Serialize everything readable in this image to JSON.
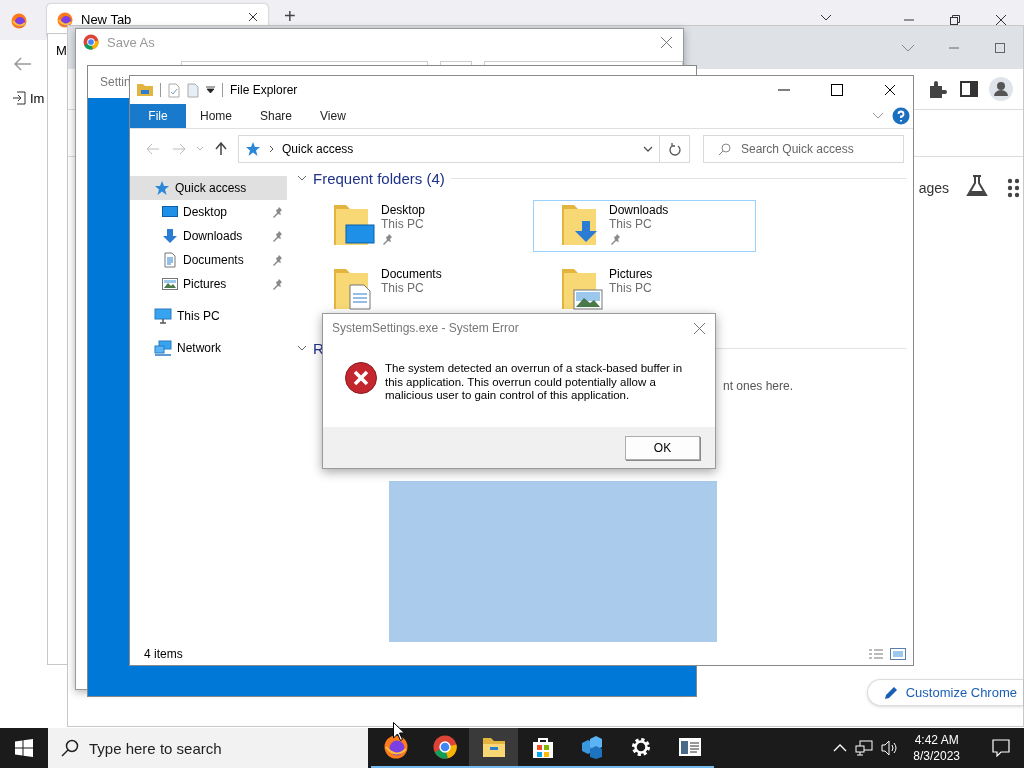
{
  "firefox": {
    "tab_title": "New Tab",
    "new_tab": "+",
    "bookmark": "Im",
    "behind_window_label": "M"
  },
  "chrome": {
    "partial_label": "ages",
    "customize_button": "Customize Chrome"
  },
  "save_as": {
    "title": "Save As"
  },
  "settings": {
    "title": "Settin"
  },
  "explorer": {
    "title": "File Explorer",
    "ribbon_tabs": [
      {
        "label": "File",
        "selected": true
      },
      {
        "label": "Home",
        "selected": false
      },
      {
        "label": "Share",
        "selected": false
      },
      {
        "label": "View",
        "selected": false
      }
    ],
    "address": "Quick access",
    "search": {
      "placeholder": "Search Quick access"
    },
    "nav": [
      {
        "label": "Quick access",
        "kind": "star",
        "selected": true,
        "children": [
          {
            "label": "Desktop",
            "kind": "desktop",
            "pinned": true,
            "selected": false
          },
          {
            "label": "Downloads",
            "kind": "download",
            "pinned": true,
            "selected": false
          },
          {
            "label": "Documents",
            "kind": "document",
            "pinned": true,
            "selected": false
          },
          {
            "label": "Pictures",
            "kind": "picture",
            "pinned": true,
            "selected": false
          }
        ]
      },
      {
        "label": "This PC",
        "kind": "pc",
        "selected": false
      },
      {
        "label": "Network",
        "kind": "network",
        "selected": false
      }
    ],
    "frequent": {
      "title": "Frequent folders (4)",
      "expanded": true,
      "folders": [
        {
          "name": "Desktop",
          "location": "This PC",
          "kind": "desktop",
          "pinned": true,
          "selected": false
        },
        {
          "name": "Downloads",
          "location": "This PC",
          "kind": "download",
          "pinned": true,
          "selected": true
        },
        {
          "name": "Documents",
          "location": "This PC",
          "kind": "document",
          "pinned": false,
          "selected": false
        },
        {
          "name": "Pictures",
          "location": "This PC",
          "kind": "picture",
          "pinned": false,
          "selected": false
        }
      ]
    },
    "recent": {
      "title": "R",
      "expanded": true,
      "text": "nt ones here."
    },
    "status": "4 items"
  },
  "dialog": {
    "title": "SystemSettings.exe - System Error",
    "message": "The system detected an overrun of a stack-based buffer in this application. This overrun could potentially allow a malicious user to gain control of this application.",
    "button": "OK"
  },
  "taskbar": {
    "search_placeholder": "Type here to search",
    "apps": [
      {
        "kind": "firefox",
        "selected": false
      },
      {
        "kind": "chrome",
        "selected": false
      },
      {
        "kind": "explorer",
        "selected": true
      },
      {
        "kind": "store",
        "selected": false
      },
      {
        "kind": "stack",
        "selected": false
      },
      {
        "kind": "settings",
        "selected": false
      },
      {
        "kind": "window",
        "selected": false
      }
    ],
    "time": "4:42 AM",
    "date": "8/3/2023"
  }
}
